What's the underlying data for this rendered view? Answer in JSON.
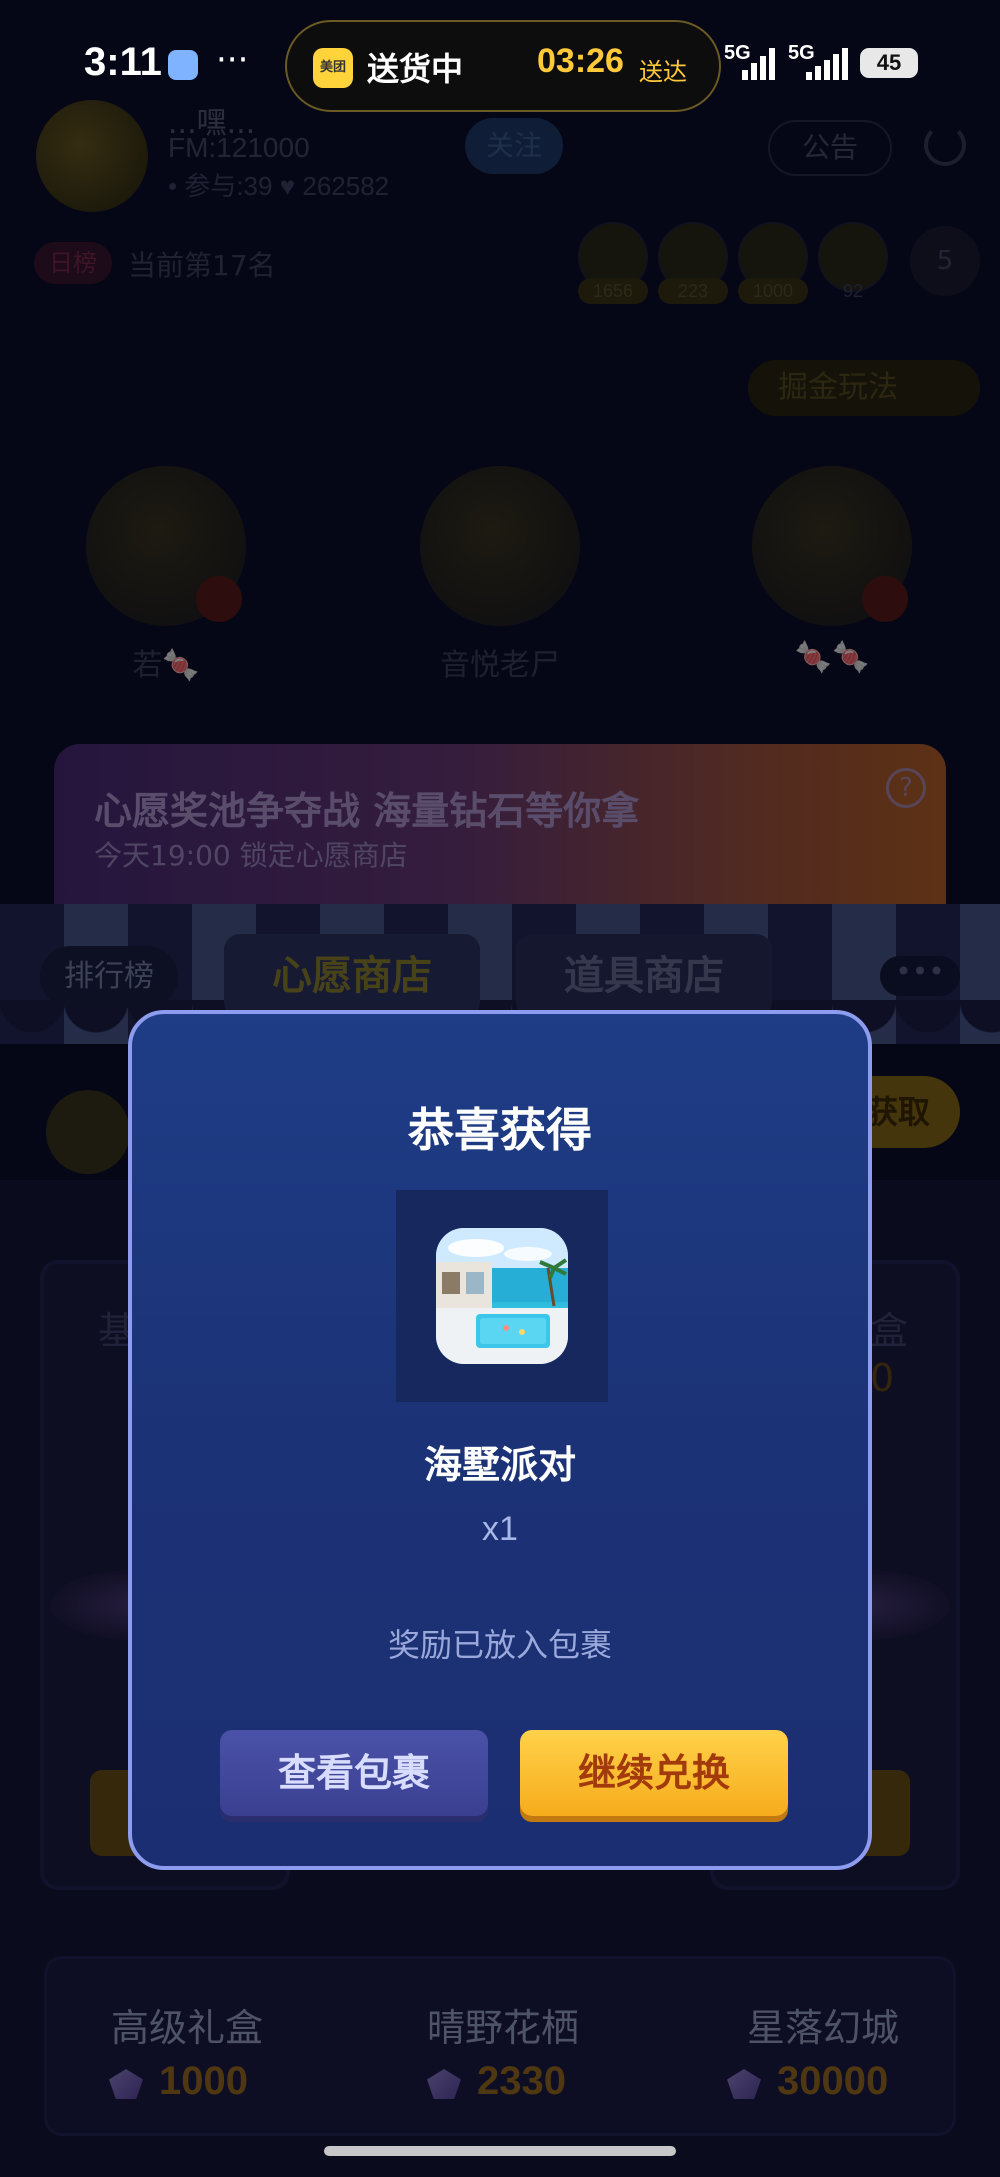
{
  "status_bar": {
    "time": "3:11",
    "more_dots": "···",
    "island": {
      "app_logo_text": "美团",
      "status": "送货中",
      "eta_time": "03:26",
      "eta_suffix": "送达"
    },
    "signal_1": "5G",
    "signal_2": "5G",
    "battery": "45"
  },
  "room": {
    "title": "...嘿...",
    "fm": "FM:121000",
    "stats": "• 参与:39   ♥ 262582",
    "follow_label": "关注",
    "notice_label": "公告",
    "rank_badge": "日榜",
    "rank_text": "当前第17名",
    "viewer_badges": [
      "1656",
      "223",
      "1000",
      "92"
    ],
    "viewer_count": "5",
    "gold_play_label": "掘金玩法",
    "seats": [
      {
        "name": "若🍬"
      },
      {
        "name": "音悦老尸"
      },
      {
        "name": "🍬🍬"
      }
    ]
  },
  "wish_banner": {
    "title": "心愿奖池争夺战 海量钻石等你拿",
    "subtitle": "今天19:00 锁定心愿商店",
    "help_icon": "?"
  },
  "tabs": {
    "rank": "排行榜",
    "wish_shop": "心愿商店",
    "tool_shop": "道具商店",
    "more": "•••"
  },
  "get_button": "获取",
  "shop": {
    "peek_left": "基",
    "peek_right": "盒",
    "peek_right_price": "0",
    "bottom_items": [
      {
        "name": "高级礼盒",
        "price": "1000"
      },
      {
        "name": "晴野花栖",
        "price": "2330"
      },
      {
        "name": "星落幻城",
        "price": "30000"
      }
    ]
  },
  "modal": {
    "title": "恭喜获得",
    "prize_name": "海墅派对",
    "quantity": "x1",
    "note": "奖励已放入包裹",
    "view_bag_label": "查看包裹",
    "continue_label": "继续兑换"
  },
  "colors": {
    "modal_border": "#8e9cf0",
    "modal_bg": "#1e3d86",
    "continue_button": "#ffc22e",
    "view_bag_button": "#434aa0",
    "eta_accent": "#ffc93a"
  }
}
